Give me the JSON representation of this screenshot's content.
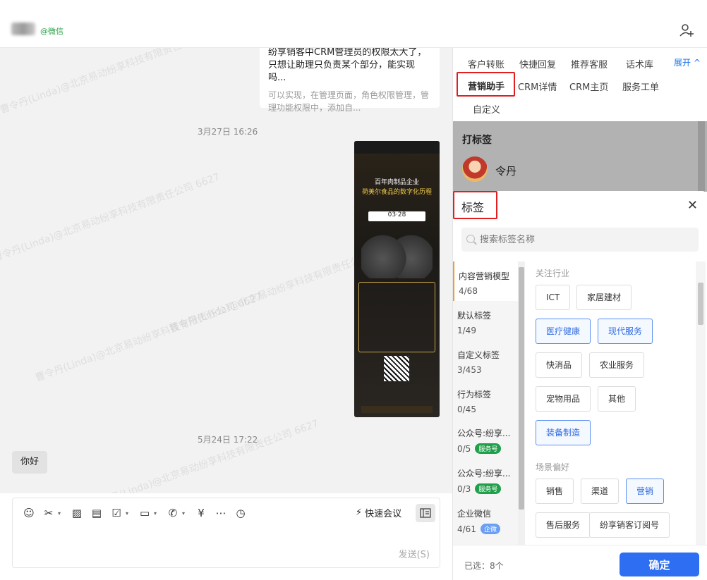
{
  "header": {
    "wechat_tag": "@微信"
  },
  "chat": {
    "card_title": "纷享销客中CRM管理员的权限太大了，只想让助理只负责某个部分，能实现吗...",
    "card_reply": "可以实现，在管理页面，角色权限管理，管理功能权限中，添加自...",
    "time1": "3月27日 16:26",
    "time2": "5月24日 17:22",
    "message": "你好",
    "watermark": "曹令丹(Linda)@北京易动纷享科技有限责任公司 6627",
    "poster": {
      "headline1": "百年肉制品企业",
      "headline2": "荷美尔食品的数字化历程",
      "date": "03·28"
    }
  },
  "composer": {
    "quick_meeting": "快速会议",
    "send": "发送(S)",
    "tools": [
      "emoji-icon",
      "scissors-icon",
      "image-icon",
      "document-icon",
      "task-icon",
      "folder-icon",
      "phone-icon",
      "yuan-icon",
      "more-icon",
      "history-icon"
    ]
  },
  "right_tabs": {
    "row1": [
      "客户转账",
      "快捷回复",
      "推荐客服",
      "话术库"
    ],
    "expand": "展开",
    "row2": [
      "营销助手",
      "CRM详情",
      "CRM主页",
      "服务工单"
    ],
    "row3": [
      "自定义"
    ]
  },
  "tag_overlay": {
    "title": "打标签",
    "contact": "令丹"
  },
  "tag_panel": {
    "title": "标签",
    "search_placeholder": "搜索标签名称",
    "categories": [
      {
        "name": "内容营销模型",
        "count": "4/68",
        "badge": ""
      },
      {
        "name": "默认标签",
        "count": "1/49",
        "badge": ""
      },
      {
        "name": "自定义标签",
        "count": "3/453",
        "badge": ""
      },
      {
        "name": "行为标签",
        "count": "0/45",
        "badge": ""
      },
      {
        "name": "公众号:纷享...",
        "count": "0/5",
        "badge": "服务号"
      },
      {
        "name": "公众号:纷享...",
        "count": "0/3",
        "badge": "服务号"
      },
      {
        "name": "企业微信",
        "count": "4/61",
        "badge": "企微"
      }
    ],
    "section1": "关注行业",
    "section1_tags": [
      "ICT",
      "家居建材",
      "医疗健康",
      "现代服务",
      "快消品",
      "农业服务",
      "宠物用品",
      "其他",
      "装备制造"
    ],
    "section2": "场景偏好",
    "section2_tags": [
      "销售",
      "渠道",
      "营销",
      "售后服务",
      "纷享销客订阅号"
    ],
    "selected_count": "已选：8个",
    "confirm": "确定"
  }
}
